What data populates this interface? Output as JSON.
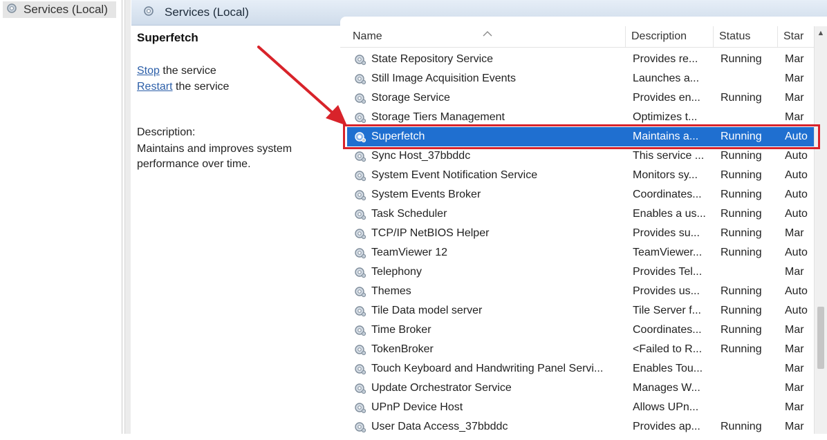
{
  "tree": {
    "root_label": "Services (Local)"
  },
  "header": {
    "title": "Services (Local)"
  },
  "extended": {
    "service_title": "Superfetch",
    "stop_link": "Stop",
    "stop_suffix": " the service",
    "restart_link": "Restart",
    "restart_suffix": " the service",
    "description_label": "Description:",
    "description_text": "Maintains and improves system performance over time."
  },
  "columns": {
    "name": "Name",
    "description": "Description",
    "status": "Status",
    "startup": "Star"
  },
  "icons": {
    "service": "gear-icon",
    "sort": "sort-ascending-icon",
    "annotation_arrow": "red-arrow-icon"
  },
  "colors": {
    "selection": "#1f6fd0",
    "annotation": "#d8232a",
    "link": "#2b5ea8"
  },
  "services": [
    {
      "name": "State Repository Service",
      "description": "Provides re...",
      "status": "Running",
      "startup": "Mar"
    },
    {
      "name": "Still Image Acquisition Events",
      "description": "Launches a...",
      "status": "",
      "startup": "Mar"
    },
    {
      "name": "Storage Service",
      "description": "Provides en...",
      "status": "Running",
      "startup": "Mar"
    },
    {
      "name": "Storage Tiers Management",
      "description": "Optimizes t...",
      "status": "",
      "startup": "Mar"
    },
    {
      "name": "Superfetch",
      "description": "Maintains a...",
      "status": "Running",
      "startup": "Auto",
      "selected": true
    },
    {
      "name": "Sync Host_37bbddc",
      "description": "This service ...",
      "status": "Running",
      "startup": "Auto"
    },
    {
      "name": "System Event Notification Service",
      "description": "Monitors sy...",
      "status": "Running",
      "startup": "Auto"
    },
    {
      "name": "System Events Broker",
      "description": "Coordinates...",
      "status": "Running",
      "startup": "Auto"
    },
    {
      "name": "Task Scheduler",
      "description": "Enables a us...",
      "status": "Running",
      "startup": "Auto"
    },
    {
      "name": "TCP/IP NetBIOS Helper",
      "description": "Provides su...",
      "status": "Running",
      "startup": "Mar"
    },
    {
      "name": "TeamViewer 12",
      "description": "TeamViewer...",
      "status": "Running",
      "startup": "Auto"
    },
    {
      "name": "Telephony",
      "description": "Provides Tel...",
      "status": "",
      "startup": "Mar"
    },
    {
      "name": "Themes",
      "description": "Provides us...",
      "status": "Running",
      "startup": "Auto"
    },
    {
      "name": "Tile Data model server",
      "description": "Tile Server f...",
      "status": "Running",
      "startup": "Auto"
    },
    {
      "name": "Time Broker",
      "description": "Coordinates...",
      "status": "Running",
      "startup": "Mar"
    },
    {
      "name": "TokenBroker",
      "description": "<Failed to R...",
      "status": "Running",
      "startup": "Mar"
    },
    {
      "name": "Touch Keyboard and Handwriting Panel Servi...",
      "description": "Enables Tou...",
      "status": "",
      "startup": "Mar"
    },
    {
      "name": "Update Orchestrator Service",
      "description": "Manages W...",
      "status": "",
      "startup": "Mar"
    },
    {
      "name": "UPnP Device Host",
      "description": "Allows UPn...",
      "status": "",
      "startup": "Mar"
    },
    {
      "name": "User Data Access_37bbddc",
      "description": "Provides ap...",
      "status": "Running",
      "startup": "Mar"
    }
  ]
}
